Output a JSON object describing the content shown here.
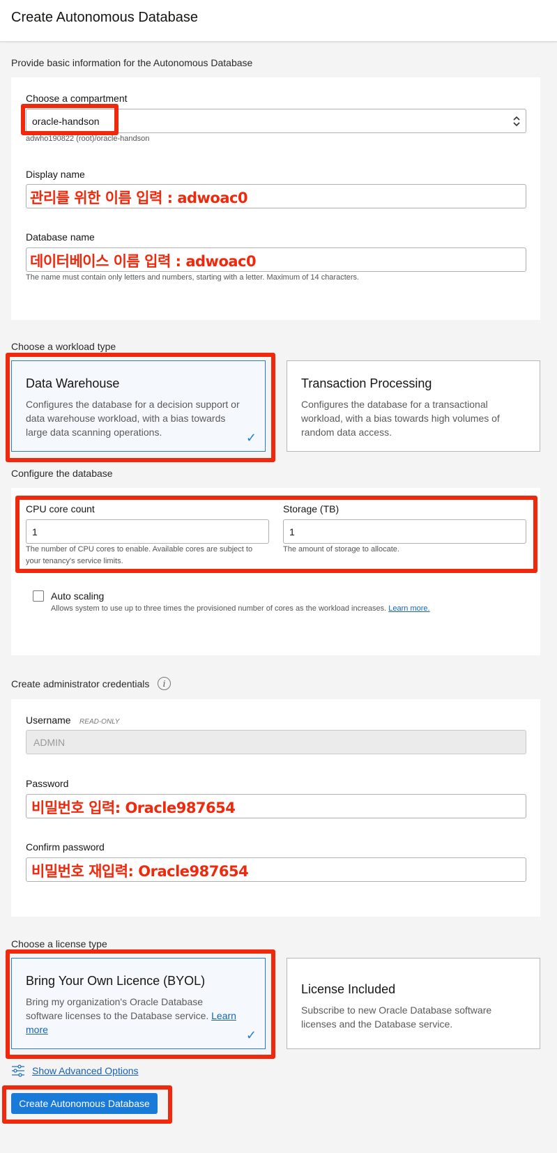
{
  "header": {
    "title": "Create Autonomous Database"
  },
  "basic": {
    "section_title": "Provide basic information for the Autonomous Database",
    "compartment": {
      "label": "Choose a compartment",
      "value": "oracle-handson",
      "path": "adwho190822 (root)/oracle-handson"
    },
    "display_name": {
      "label": "Display name",
      "annotation": "관리를 위한 이름 입력 : adwoac0"
    },
    "database_name": {
      "label": "Database name",
      "annotation": "데이터베이스 이름 입력 : adwoac0",
      "hint": "The name must contain only letters and numbers, starting with a letter. Maximum of 14 characters."
    }
  },
  "workload": {
    "section_title": "Choose a workload type",
    "options": [
      {
        "title": "Data Warehouse",
        "desc": "Configures the database for a decision support or data warehouse workload, with a bias towards large data scanning operations."
      },
      {
        "title": "Transaction Processing",
        "desc": "Configures the database for a transactional workload, with a bias towards high volumes of random data access."
      }
    ],
    "selected": "Data Warehouse"
  },
  "configure": {
    "section_title": "Configure the database",
    "cpu": {
      "label": "CPU core count",
      "value": "1",
      "hint": "The number of CPU cores to enable. Available cores are subject to your tenancy's service limits."
    },
    "storage": {
      "label": "Storage (TB)",
      "value": "1",
      "hint": "The amount of storage to allocate."
    },
    "auto_scaling": {
      "label": "Auto scaling",
      "hint": "Allows system to use up to three times the provisioned number of cores as the workload increases.",
      "link": "Learn more.",
      "checked": false
    }
  },
  "admin": {
    "section_title": "Create administrator credentials",
    "username": {
      "label": "Username",
      "tag": "READ-ONLY",
      "value": "ADMIN"
    },
    "password": {
      "label": "Password",
      "annotation": "비밀번호 입력: Oracle987654"
    },
    "confirm": {
      "label": "Confirm password",
      "annotation": "비밀번호 재입력: Oracle987654"
    }
  },
  "license": {
    "section_title": "Choose a license type",
    "options": [
      {
        "title": "Bring Your Own Licence (BYOL)",
        "desc": "Bring my organization's Oracle Database software licenses to the Database service.",
        "link": "Learn more"
      },
      {
        "title": "License Included",
        "desc": "Subscribe to new Oracle Database software licenses and the Database service."
      }
    ],
    "selected": "Bring Your Own Licence (BYOL)"
  },
  "advanced_link": "Show Advanced Options",
  "submit_label": "Create Autonomous Database",
  "colors": {
    "annotation_red": "#f0290d",
    "primary_blue": "#1a7ad8",
    "selected_border": "#2a7bd5"
  }
}
